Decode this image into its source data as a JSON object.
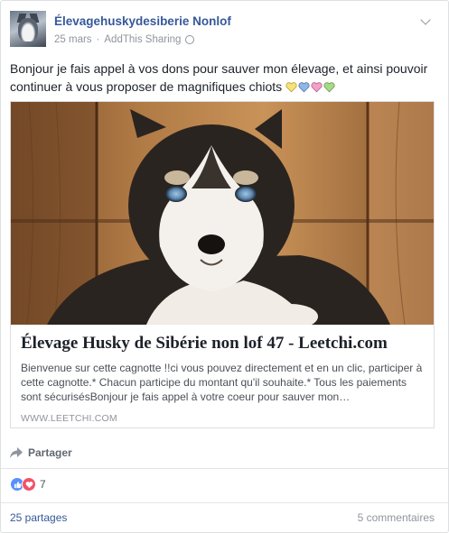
{
  "post": {
    "page_name": "Élevagehuskydesiberie Nonlof",
    "date": "25 mars",
    "separator": "·",
    "via": "AddThis Sharing",
    "text": "Bonjour je fais appel à vos dons pour sauver mon élevage, et ainsi pouvoir continuer à vous proposer de magnifiques chiots"
  },
  "hearts": [
    "#f7e27a",
    "#8fb6e8",
    "#f2a0c8",
    "#a8d88a"
  ],
  "link": {
    "title": "Élevage Husky de Sibérie non lof 47 - Leetchi.com",
    "description": "Bienvenue sur cette cagnotte !!ci vous pouvez directement et en un clic, participer à cette cagnotte.* Chacun participe du montant qu'il souhaite.* Tous les paiements sont sécurisésBonjour je fais appel à votre coeur pour sauver mon…",
    "domain": "WWW.LEETCHI.COM"
  },
  "actions": {
    "share_label": "Partager"
  },
  "reactions": {
    "count": "7"
  },
  "footer": {
    "shares": "25 partages",
    "comments": "5 commentaires"
  },
  "colors": {
    "link_blue": "#365899",
    "like_blue": "#5890ff",
    "love_red": "#f25268"
  }
}
